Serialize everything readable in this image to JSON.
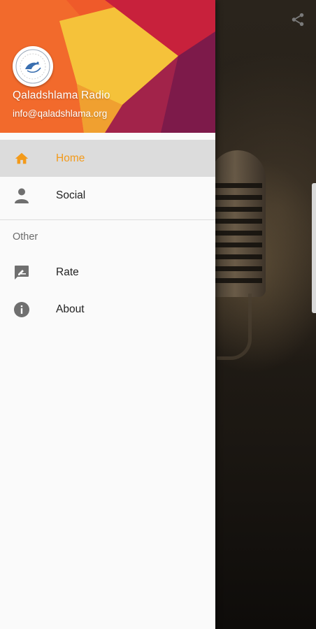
{
  "header": {
    "app_name": "Qaladshlama Radio",
    "email": "info@qaladshlama.org"
  },
  "menu": {
    "primary": [
      {
        "label": "Home",
        "icon": "home-icon",
        "active": true
      },
      {
        "label": "Social",
        "icon": "person-icon",
        "active": false
      }
    ],
    "section_label": "Other",
    "secondary": [
      {
        "label": "Rate",
        "icon": "rate-feedback-icon"
      },
      {
        "label": "About",
        "icon": "info-icon"
      }
    ]
  },
  "colors": {
    "accent": "#f39a1a",
    "active_bg": "#dcdcdc",
    "header_orange": "#f26a2c",
    "header_yellow": "#f5c23a",
    "header_red": "#c8213c",
    "header_maroon": "#7d1a4a"
  },
  "toolbar": {
    "share_icon": "share-icon"
  }
}
